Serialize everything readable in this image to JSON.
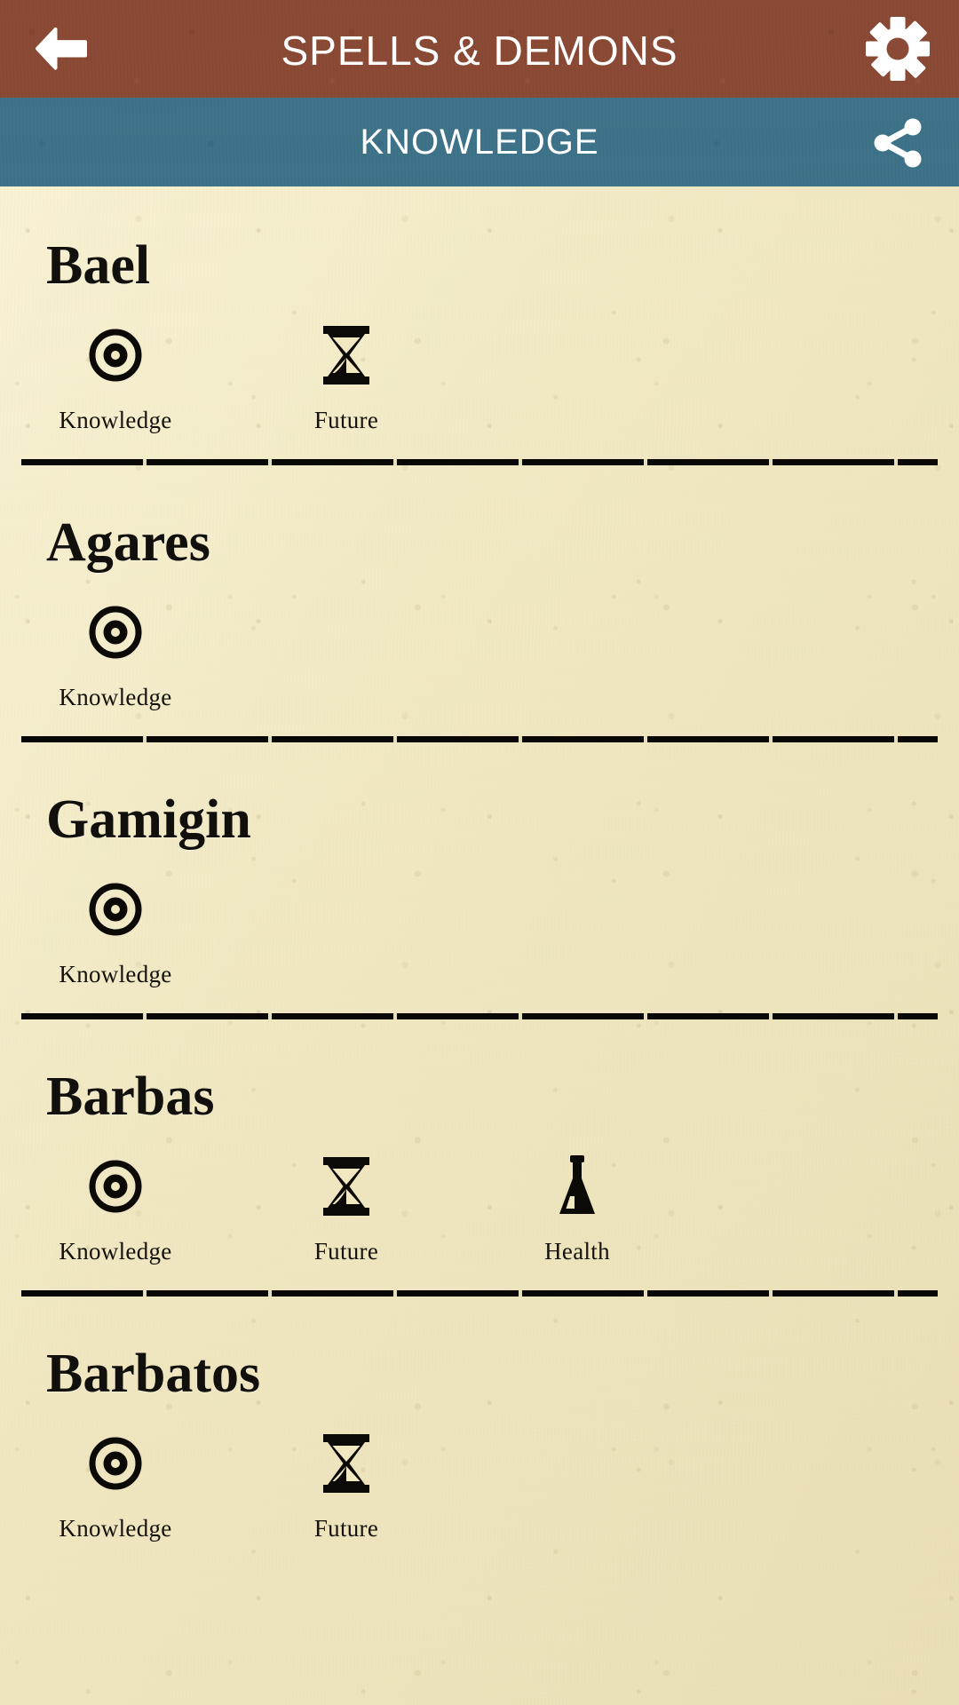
{
  "header": {
    "back_icon": "back-arrow-icon",
    "title": "SPELLS & DEMONS",
    "settings_icon": "gear-icon",
    "brown_color": "#8b4a35"
  },
  "subheader": {
    "title": "KNOWLEDGE",
    "share_icon": "share-icon",
    "teal_color": "#3e7389"
  },
  "trait_icons": {
    "knowledge": "eye-icon",
    "future": "hourglass-icon",
    "health": "flask-icon"
  },
  "list": {
    "items": [
      {
        "name": "Bael",
        "traits": [
          {
            "label": "Knowledge",
            "icon": "eye-icon"
          },
          {
            "label": "Future",
            "icon": "hourglass-icon"
          }
        ]
      },
      {
        "name": "Agares",
        "traits": [
          {
            "label": "Knowledge",
            "icon": "eye-icon"
          }
        ]
      },
      {
        "name": "Gamigin",
        "traits": [
          {
            "label": "Knowledge",
            "icon": "eye-icon"
          }
        ]
      },
      {
        "name": "Barbas",
        "traits": [
          {
            "label": "Knowledge",
            "icon": "eye-icon"
          },
          {
            "label": "Future",
            "icon": "hourglass-icon"
          },
          {
            "label": "Health",
            "icon": "flask-icon"
          }
        ]
      },
      {
        "name": "Barbatos",
        "traits": [
          {
            "label": "Knowledge",
            "icon": "eye-icon"
          },
          {
            "label": "Future",
            "icon": "hourglass-icon"
          }
        ]
      }
    ]
  }
}
